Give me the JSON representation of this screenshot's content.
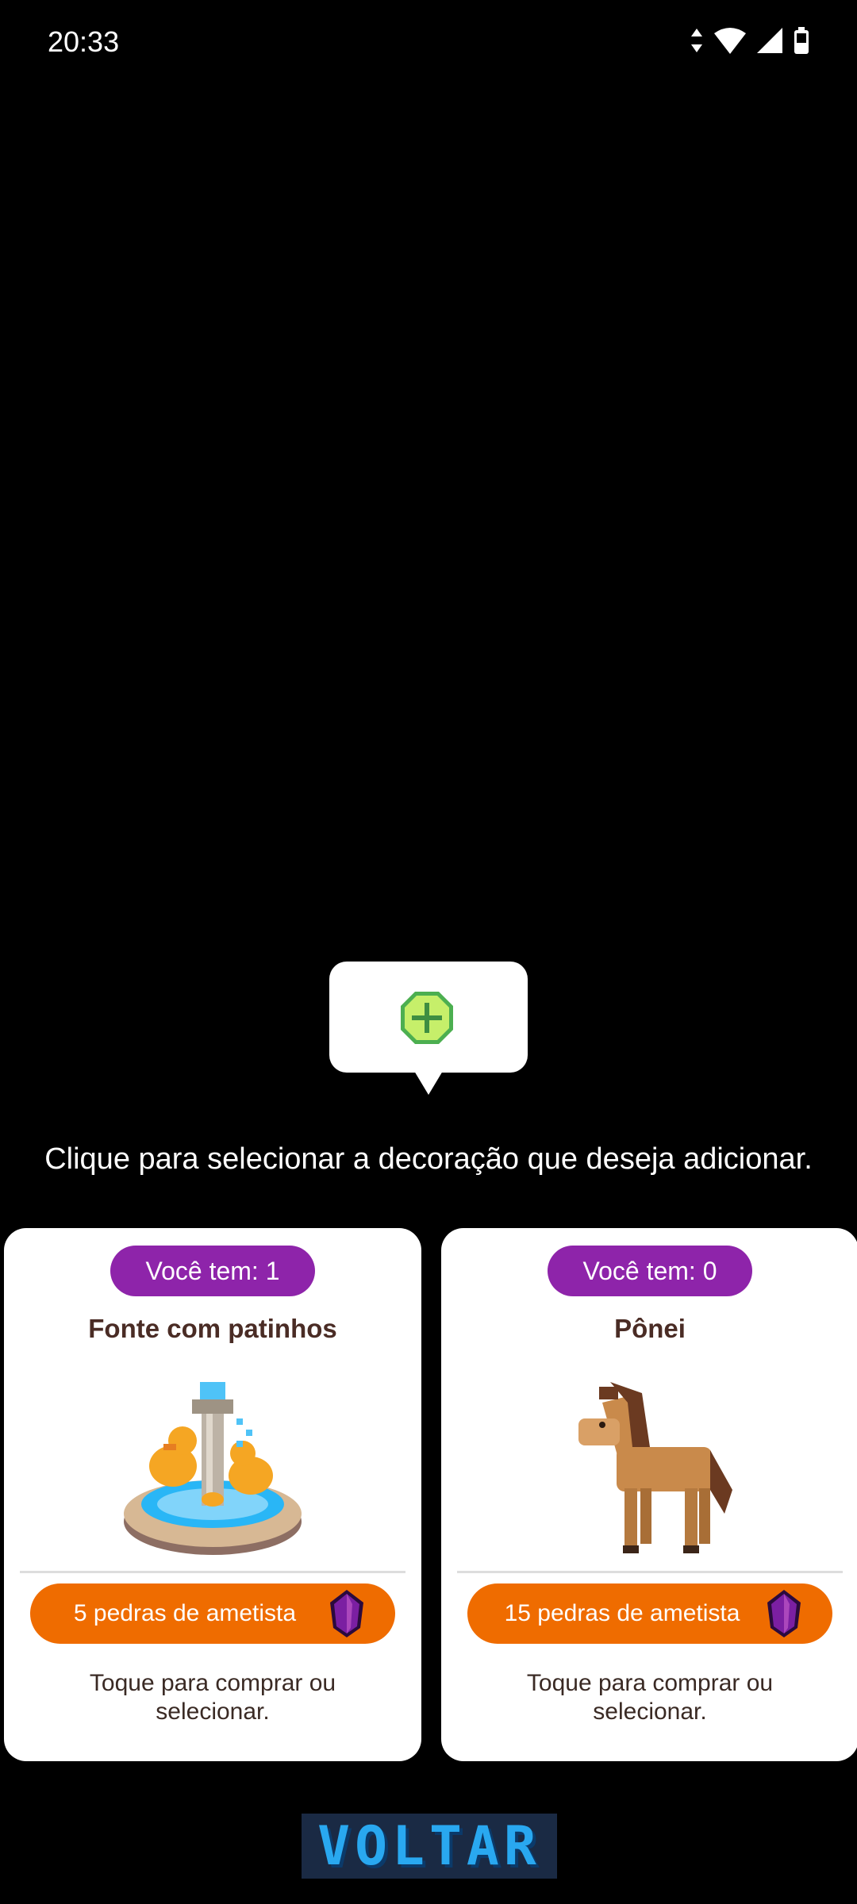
{
  "status_bar": {
    "time": "20:33",
    "icons": [
      "data-arrows-icon",
      "wifi-icon",
      "signal-icon",
      "battery-icon"
    ]
  },
  "tooltip": {
    "icon": "add-icon"
  },
  "instruction": "Clique para selecionar a decoração que deseja adicionar.",
  "cards": [
    {
      "owned": "Você tem: 1",
      "title": "Fonte com patinhos",
      "image": "duck-fountain-image",
      "price": "5 pedras de ametista",
      "price_icon": "amethyst-gem-icon",
      "hint": "Toque para comprar ou selecionar."
    },
    {
      "owned": "Você tem: 0",
      "title": "Pônei",
      "image": "pony-image",
      "price": "15 pedras de ametista",
      "price_icon": "amethyst-gem-icon",
      "hint": "Toque para comprar ou selecionar."
    }
  ],
  "back_button": {
    "label": "VOLTAR"
  },
  "colors": {
    "badge": "#8e24aa",
    "price": "#ef6c00",
    "back_text": "#29a8f0",
    "back_bg": "#1a2a44"
  }
}
